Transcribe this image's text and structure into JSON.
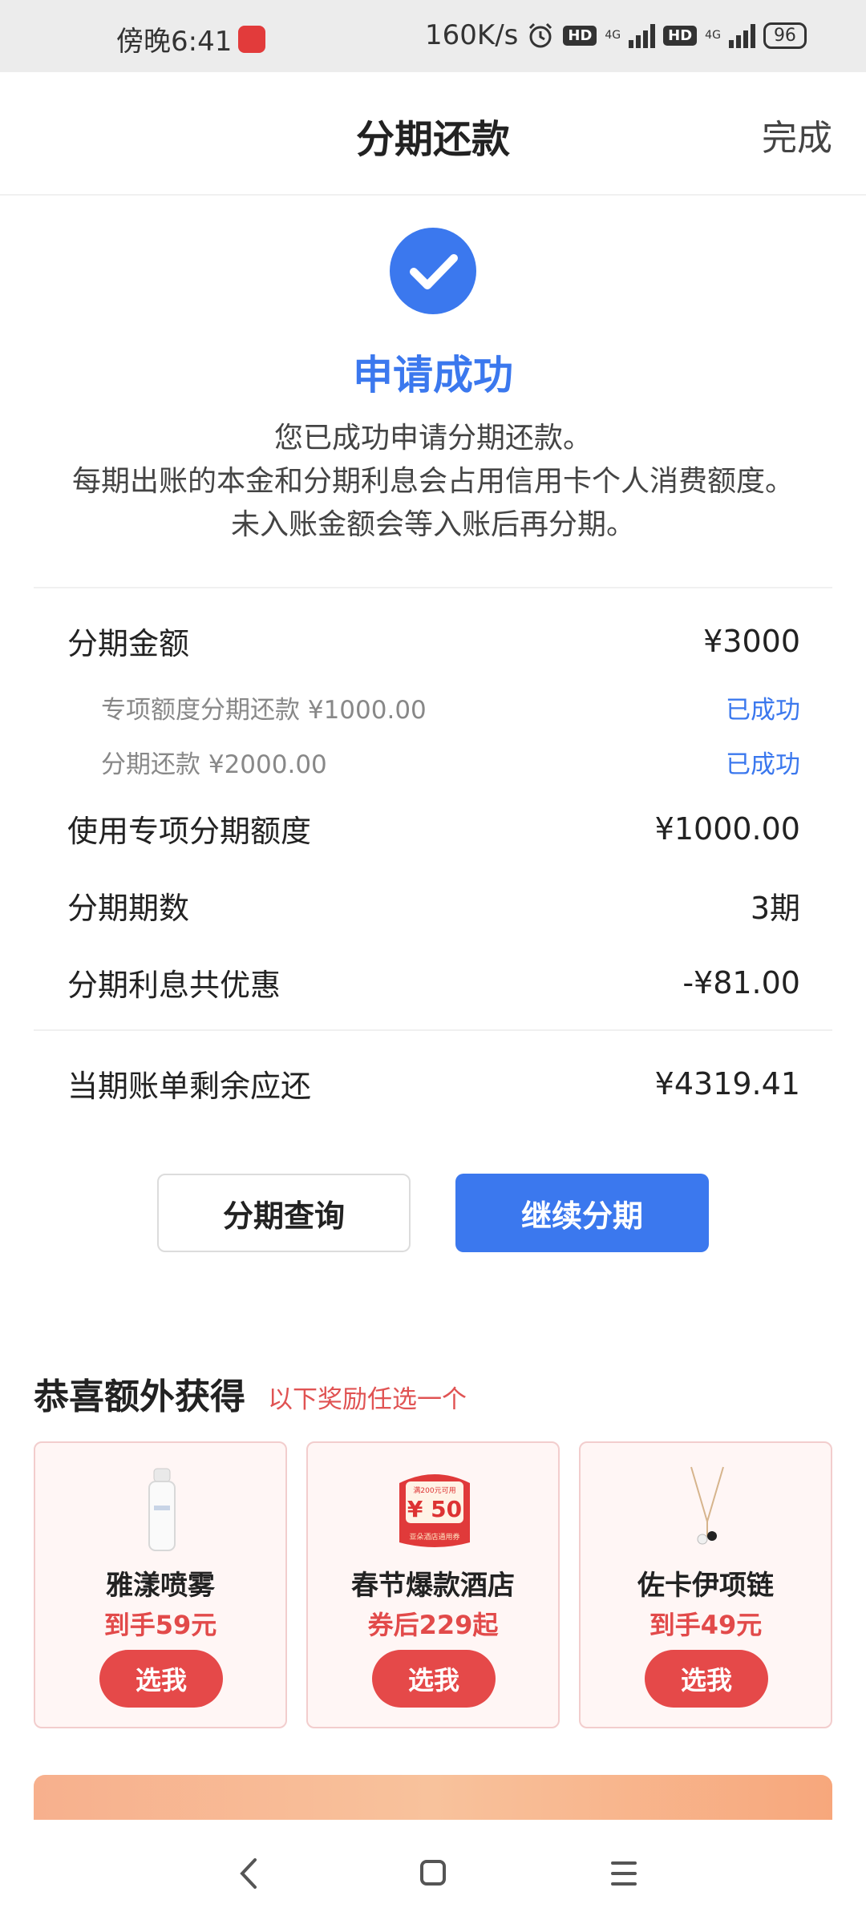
{
  "status_bar": {
    "time": "傍晚6:41",
    "speed": "160K/s",
    "hd1": "HD",
    "hd2": "HD",
    "net1": "4G",
    "net2": "4G",
    "battery": "96"
  },
  "header": {
    "title": "分期还款",
    "done": "完成"
  },
  "success": {
    "title": "申请成功",
    "desc_line1": "您已成功申请分期还款。",
    "desc_line2": "每期出账的本金和分期利息会占用信用卡个人消费额度。未入账金额会等入账后再分期。"
  },
  "details": {
    "amount_label": "分期金额",
    "amount_value": "¥3000",
    "sub1_label": "专项额度分期还款 ¥1000.00",
    "sub1_status": "已成功",
    "sub2_label": "分期还款 ¥2000.00",
    "sub2_status": "已成功",
    "quota_label": "使用专项分期额度",
    "quota_value": "¥1000.00",
    "periods_label": "分期期数",
    "periods_value": "3期",
    "discount_label": "分期利息共优惠",
    "discount_value": "-¥81.00",
    "remaining_label": "当期账单剩余应还",
    "remaining_value": "¥4319.41"
  },
  "buttons": {
    "query": "分期查询",
    "continue": "继续分期"
  },
  "rewards": {
    "title": "恭喜额外获得",
    "subtitle": "以下奖励任选一个",
    "items": [
      {
        "name": "雅漾喷雾",
        "price": "到手59元",
        "button": "选我"
      },
      {
        "name": "春节爆款酒店",
        "price": "券后229起",
        "button": "选我",
        "coupon_top": "满200元可用",
        "coupon_value": "¥ 50",
        "coupon_bottom": "亚朵酒店通用券"
      },
      {
        "name": "佐卡伊项链",
        "price": "到手49元",
        "button": "选我"
      }
    ]
  },
  "colors": {
    "primary": "#3b78ee",
    "accent_red": "#e54949"
  }
}
